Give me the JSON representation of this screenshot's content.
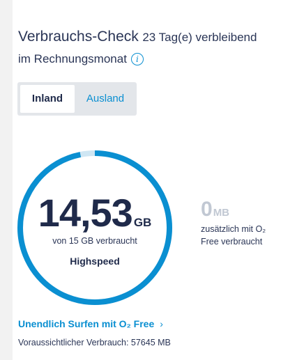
{
  "header": {
    "title": "Verbrauchs-Check",
    "remaining": "23 Tag(e) verbleibend",
    "period": "im Rechnungsmonat",
    "info_icon": "info-icon"
  },
  "tabs": [
    {
      "label": "Inland",
      "selected": true
    },
    {
      "label": "Ausland",
      "selected": false
    }
  ],
  "usage": {
    "used_value": "14,53",
    "used_unit": "GB",
    "total_text": "von 15 GB verbraucht",
    "speed": "Highspeed",
    "used_fraction": 0.9687
  },
  "extra": {
    "value": "0",
    "unit": "MB",
    "line1": "zusätzlich mit O₂",
    "line2": "Free verbraucht"
  },
  "link": {
    "label": "Unendlich Surfen mit O₂ Free",
    "icon": "chevron-right-icon"
  },
  "forecast": "Voraussichtlicher Verbrauch: 57645 MB",
  "colors": {
    "accent": "#0a8fd1",
    "track": "#cfe6f3",
    "text": "#1f2a4a",
    "muted": "#c1c8d3"
  }
}
